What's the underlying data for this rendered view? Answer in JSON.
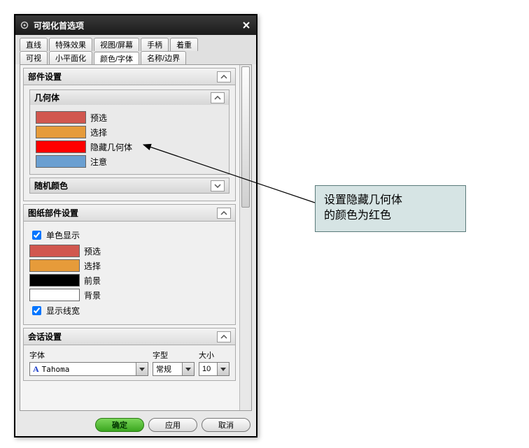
{
  "window": {
    "title": "可视化首选项"
  },
  "tabs_row1": [
    "直线",
    "特殊效果",
    "视图/屏幕",
    "手柄",
    "着重"
  ],
  "tabs_row2": [
    "可视",
    "小平面化",
    "颜色/字体",
    "名称/边界"
  ],
  "active_tab": "颜色/字体",
  "sections": {
    "part_settings": {
      "title": "部件设置"
    },
    "geometry": {
      "title": "几何体",
      "rows": [
        {
          "color": "#d1574f",
          "label": "预选"
        },
        {
          "color": "#e69b3a",
          "label": "选择"
        },
        {
          "color": "#ff0000",
          "label": "隐藏几何体"
        },
        {
          "color": "#6a9fd1",
          "label": "注意"
        }
      ]
    },
    "random_color": {
      "title": "随机颜色"
    },
    "drawing_part_settings": {
      "title": "图纸部件设置",
      "monochrome_label": "单色显示",
      "monochrome_checked": true,
      "rows": [
        {
          "color": "#d1574f",
          "label": "预选"
        },
        {
          "color": "#e69b3a",
          "label": "选择"
        },
        {
          "color": "#000000",
          "label": "前景"
        },
        {
          "color": "#ffffff",
          "label": "背景"
        }
      ],
      "linewidth_label": "显示线宽",
      "linewidth_checked": true
    },
    "session": {
      "title": "会话设置",
      "font_label": "字体",
      "font_value": "Tahoma",
      "style_label": "字型",
      "style_value": "常规",
      "size_label": "大小",
      "size_value": "10"
    }
  },
  "buttons": {
    "ok": "确定",
    "apply": "应用",
    "cancel": "取消"
  },
  "callout": {
    "line1": "设置隐藏几何体",
    "line2": "的颜色为红色"
  }
}
